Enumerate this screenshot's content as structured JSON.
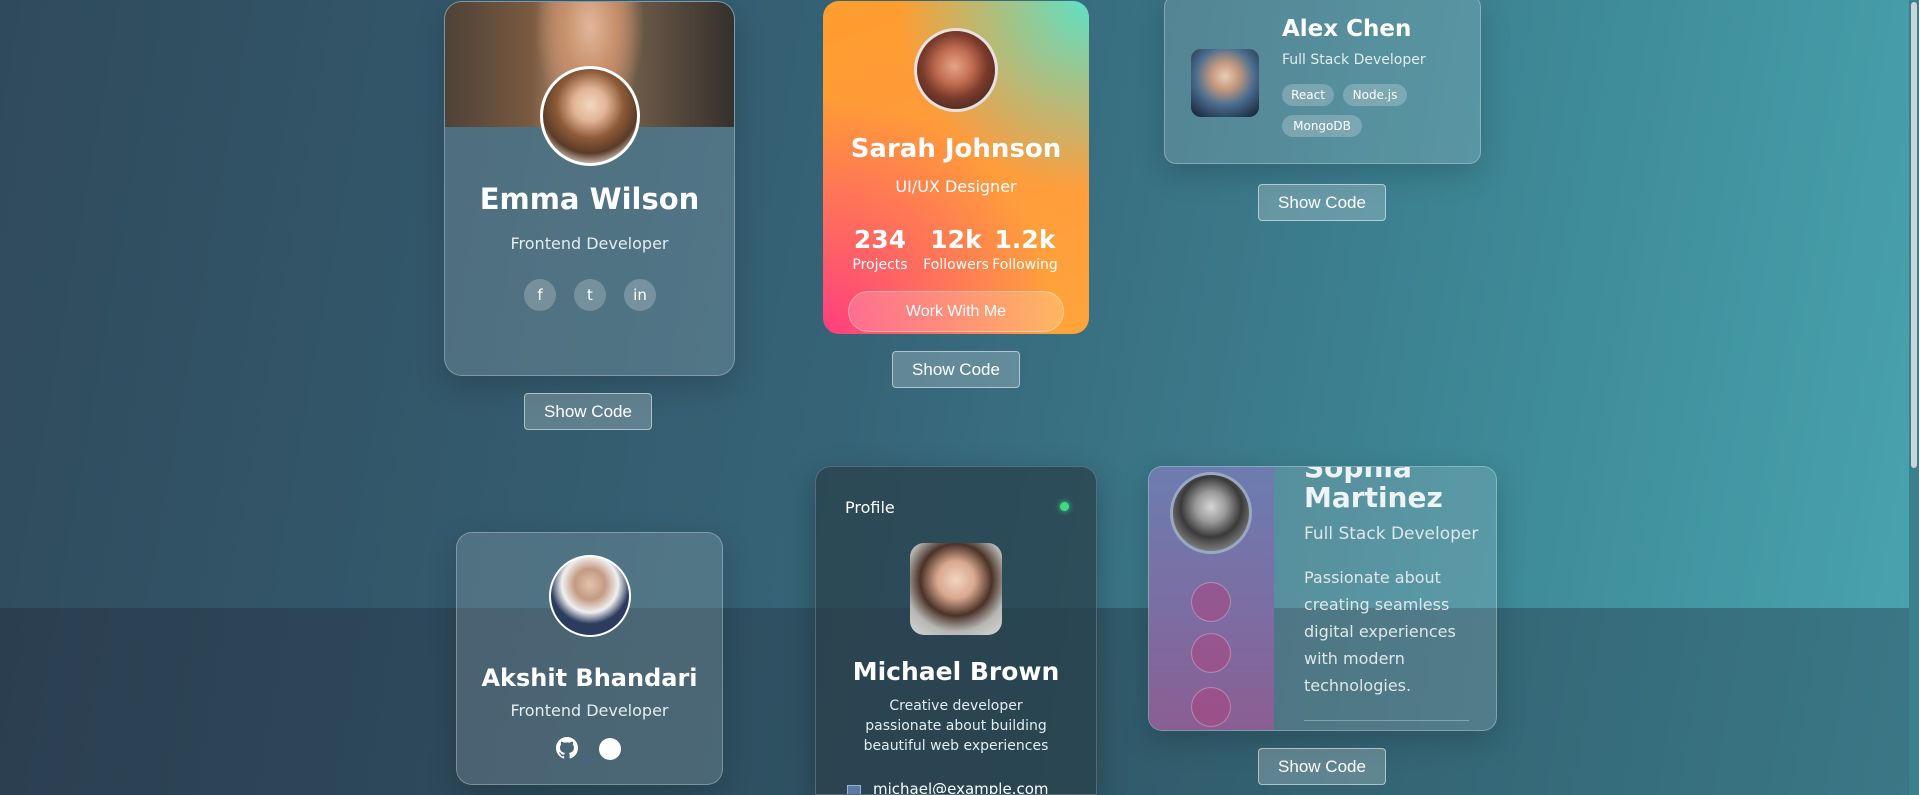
{
  "emma": {
    "name": "Emma Wilson",
    "role": "Frontend Developer",
    "socials": [
      "f",
      "t",
      "in"
    ]
  },
  "sarah": {
    "name": "Sarah Johnson",
    "role": "UI/UX Designer",
    "stats": [
      {
        "value": "234",
        "label": "Projects"
      },
      {
        "value": "12k",
        "label": "Followers"
      },
      {
        "value": "1.2k",
        "label": "Following"
      }
    ],
    "cta": "Work With Me"
  },
  "alex": {
    "name": "Alex Chen",
    "role": "Full Stack Developer",
    "tags": [
      "React",
      "Node.js",
      "MongoDB"
    ]
  },
  "akshit": {
    "name": "Akshit Bhandari",
    "role": "Frontend Developer"
  },
  "michael": {
    "header": "Profile",
    "name": "Michael Brown",
    "bio": "Creative developer passionate about building beautiful web experiences",
    "email": "michael@example.com"
  },
  "sophia": {
    "name_line1": "Sophia",
    "name_line2": "Martinez",
    "role": "Full Stack Developer",
    "bio": "Passionate about creating seamless digital experiences with modern technologies."
  },
  "buttons": {
    "show_code": "Show Code"
  },
  "colors": {
    "online_dot": "#3ddc84",
    "sarah_accent": "#ff9d2e"
  }
}
